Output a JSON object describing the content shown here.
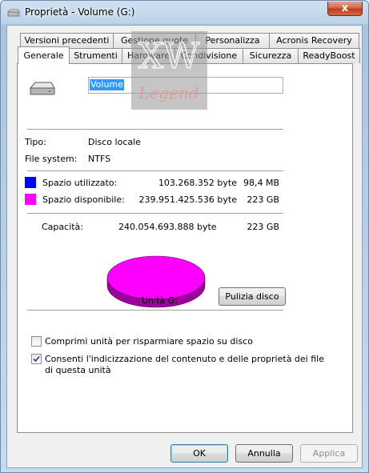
{
  "window": {
    "title": "Proprietà - Volume (G:)",
    "close_symbol": "x"
  },
  "tabs_back": [
    "Versioni precedenti",
    "Gestione quote",
    "Personalizza",
    "Acronis Recovery"
  ],
  "tabs_front": [
    "Generale",
    "Strumenti",
    "Hardware",
    "Condivisione",
    "Sicurezza",
    "ReadyBoost"
  ],
  "active_tab": "Generale",
  "general": {
    "volume_name": "Volume",
    "type_label": "Tipo:",
    "type_value": "Disco locale",
    "fs_label": "File system:",
    "fs_value": "NTFS",
    "used_label": "Spazio utilizzato:",
    "used_bytes": "103.268.352 byte",
    "used_human": "98,4 MB",
    "free_label": "Spazio disponibile:",
    "free_bytes": "239.951.425.536 byte",
    "free_human": "223 GB",
    "capacity_label": "Capacità:",
    "capacity_bytes": "240.054.693.888 byte",
    "capacity_human": "223 GB",
    "drive_label": "Unità G:",
    "cleanup_button": "Pulizia disco",
    "compress_label": "Comprimi unità per risparmiare spazio su disco",
    "compress_checked": false,
    "index_label_line1": "Consenti l'indicizzazione del contenuto e delle proprietà dei file",
    "index_label_line2": "di questa unità",
    "index_checked": true,
    "used_fraction": 0.00043,
    "colors": {
      "used": "#0000ff",
      "free": "#ff00ff",
      "free_side": "#9a009a"
    }
  },
  "watermark": {
    "text_top": "XW",
    "text_bottom": "Legend"
  },
  "buttons": {
    "ok": "OK",
    "cancel": "Annulla",
    "apply": "Applica"
  },
  "icons": {
    "title": "drive-icon",
    "drive": "hard-drive-icon"
  }
}
